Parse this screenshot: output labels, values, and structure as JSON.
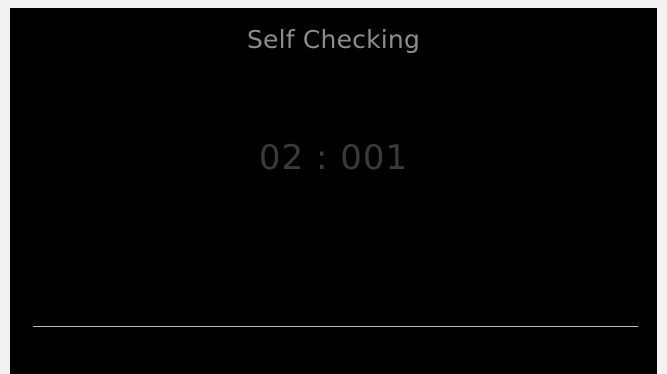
{
  "screen": {
    "title": "Self Checking",
    "timer": "02 : 001"
  }
}
